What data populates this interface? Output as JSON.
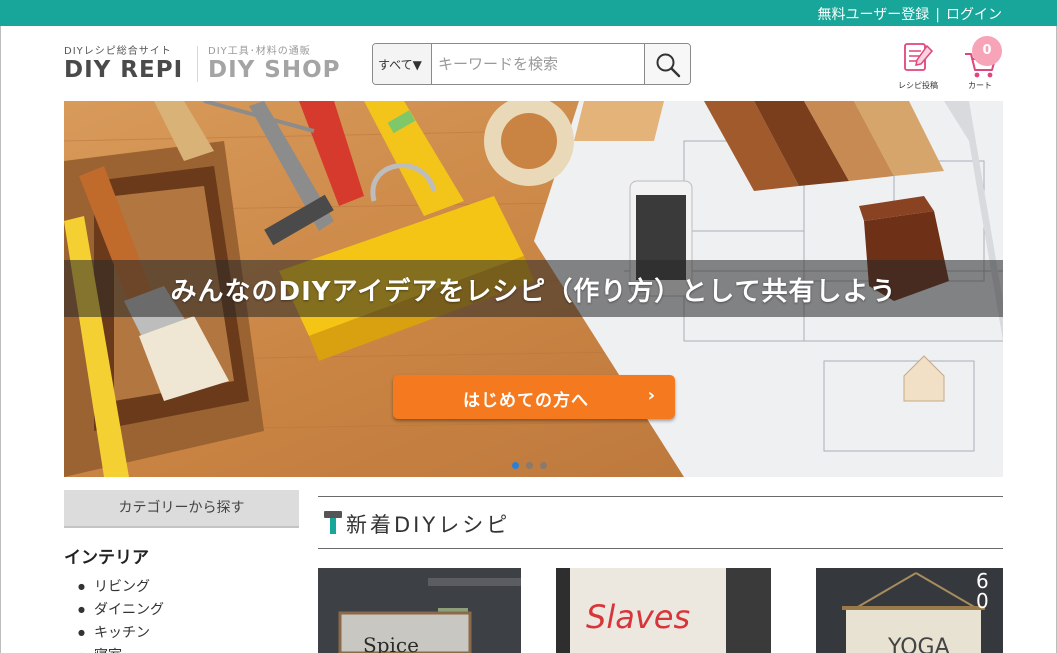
{
  "header": {
    "register_link": "無料ユーザー登録",
    "separator": "|",
    "login_link": "ログイン"
  },
  "logos": {
    "recipe_caption": "DIYレシピ総合サイト",
    "recipe_name": "DIY REPI",
    "shop_caption": "DIY工具･材料の通販",
    "shop_name": "DIY SHOP"
  },
  "search": {
    "category_selected": "すべて▼",
    "placeholder": "キーワードを検索"
  },
  "nav": {
    "recipe_post_label": "レシピ投稿",
    "cart_label": "カート",
    "cart_count": "0"
  },
  "hero": {
    "title": "みんなのDIYアイデアをレシピ（作り方）として共有しよう",
    "cta_label": "はじめての方へ",
    "cta_chevron": "›",
    "slide_count": 3,
    "active_slide": 1
  },
  "sidebar": {
    "category_header": "カテゴリーから探す",
    "section_title": "インテリア",
    "items": [
      "リビング",
      "ダイニング",
      "キッチン",
      "寝室"
    ]
  },
  "main": {
    "section_title": "新着DIYレシピ",
    "cards": [
      {
        "sign_text": "Spice"
      },
      {
        "sign_text": "Slaves"
      },
      {
        "sign_text": "YOGA",
        "corner_text": "6\n0"
      }
    ]
  },
  "colors": {
    "topbar": "#17a699",
    "cta": "#f4791f",
    "cart_badge": "#f7a3b8",
    "active_dot": "#2a7fd6"
  }
}
